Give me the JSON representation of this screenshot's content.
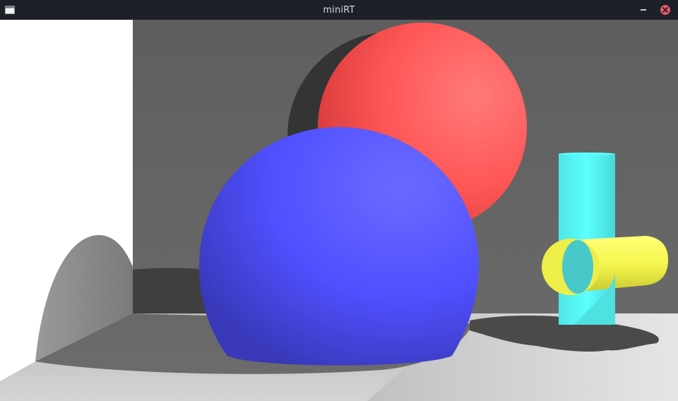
{
  "window": {
    "title": "miniRT",
    "icons": {
      "app": "window-icon",
      "minimize": "minimize-icon",
      "close": "close-icon"
    },
    "colors": {
      "titlebar": "#1d2026",
      "close": "#e05a6a"
    }
  },
  "scene": {
    "objects": [
      {
        "type": "sphere",
        "color": "#ff5a5a"
      },
      {
        "type": "sphere",
        "color": "#5a5aff"
      },
      {
        "type": "cylinder",
        "color": "#5affff"
      },
      {
        "type": "cylinder",
        "color": "#ffff5a"
      },
      {
        "type": "plane",
        "color": "#ffffff"
      }
    ]
  }
}
